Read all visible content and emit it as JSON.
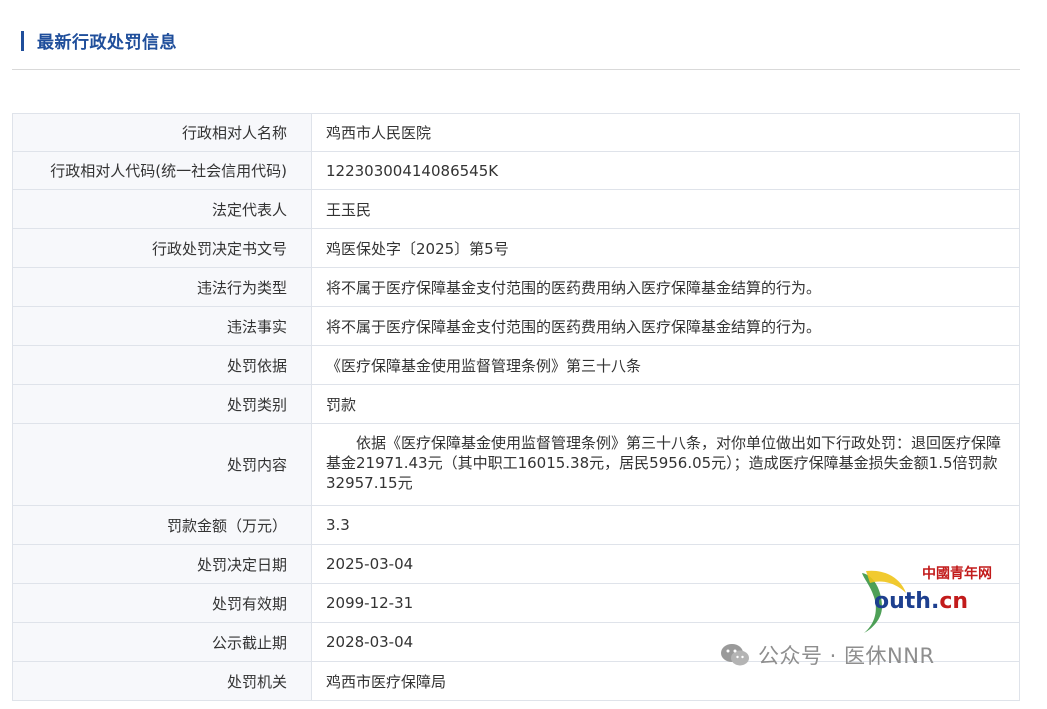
{
  "section": {
    "title": "最新行政处罚信息"
  },
  "rows": [
    {
      "label": "行政相对人名称",
      "value": "鸡西市人民医院"
    },
    {
      "label": "行政相对人代码(统一社会信用代码)",
      "value": "12230300414086545K"
    },
    {
      "label": "法定代表人",
      "value": "王玉民"
    },
    {
      "label": "行政处罚决定书文号",
      "value": "鸡医保处字〔2025〕第5号"
    },
    {
      "label": "违法行为类型",
      "value": "将不属于医疗保障基金支付范围的医药费用纳入医疗保障基金结算的行为。"
    },
    {
      "label": "违法事实",
      "value": "将不属于医疗保障基金支付范围的医药费用纳入医疗保障基金结算的行为。"
    },
    {
      "label": "处罚依据",
      "value": "《医疗保障基金使用监督管理条例》第三十八条"
    },
    {
      "label": "处罚类别",
      "value": "罚款"
    },
    {
      "label": "处罚内容",
      "value": "依据《医疗保障基金使用监督管理条例》第三十八条，对你单位做出如下行政处罚：退回医疗保障基金21971.43元（其中职工16015.38元，居民5956.05元）；造成医疗保障基金损失金额1.5倍罚款32957.15元"
    },
    {
      "label": "罚款金额（万元）",
      "value": "3.3"
    },
    {
      "label": "处罚决定日期",
      "value": "2025-03-04"
    },
    {
      "label": "处罚有效期",
      "value": "2099-12-31"
    },
    {
      "label": "公示截止期",
      "value": "2028-03-04"
    },
    {
      "label": "处罚机关",
      "value": "鸡西市医疗保障局"
    }
  ],
  "watermark": {
    "site_sub": "中國青年网",
    "site_main": "outh.",
    "site_suffix": "cn",
    "account": "公众号 · 医休NNR",
    "icon": "wechat-icon"
  },
  "colors": {
    "accent": "#1f4e9b",
    "border": "#dfe3ea"
  }
}
